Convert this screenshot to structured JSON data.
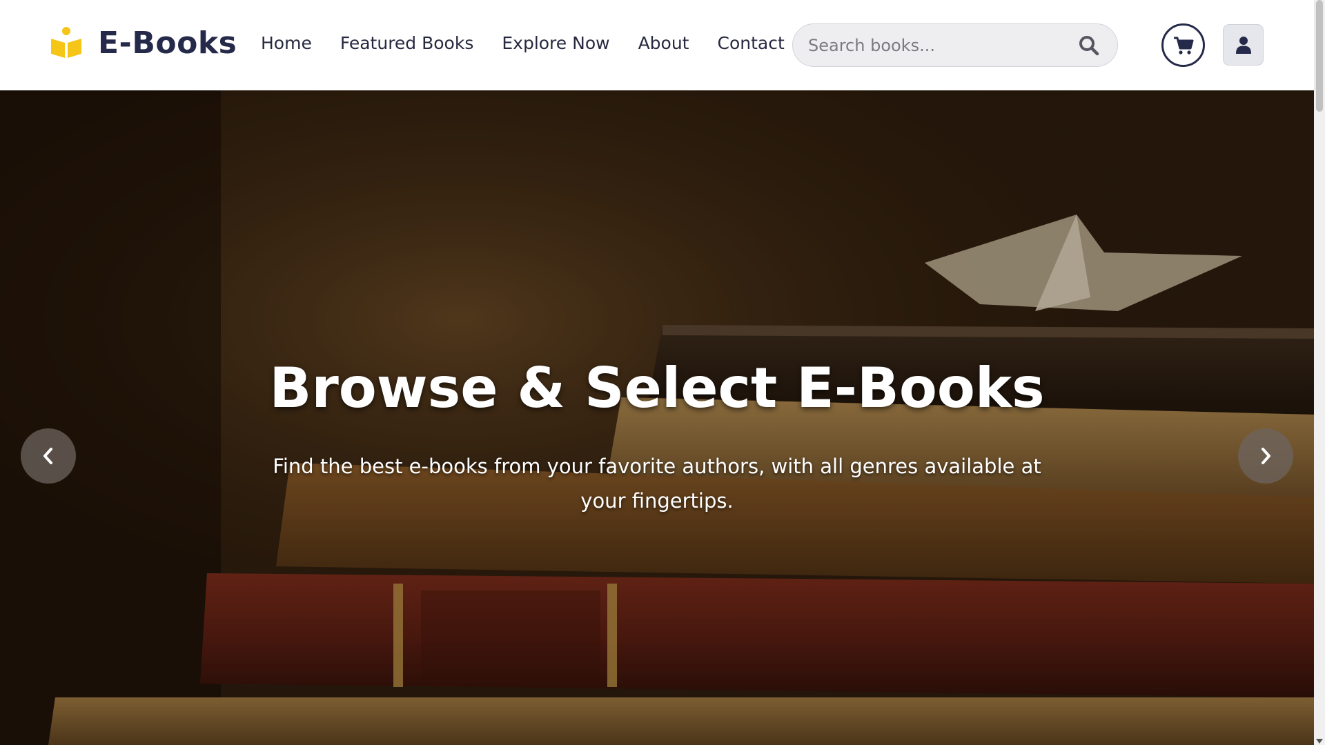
{
  "header": {
    "brand_name": "E-Books",
    "brand_icon": "book-reader-icon",
    "brand_color": "#f5c518",
    "nav": [
      "Home",
      "Featured Books",
      "Explore Now",
      "About",
      "Contact"
    ],
    "search": {
      "placeholder": "Search books...",
      "value": ""
    },
    "cart_icon": "shopping-cart-icon",
    "user_icon": "user-icon"
  },
  "hero": {
    "title": "Browse & Select E-Books",
    "subtitle": "Find the best e-books from your favorite authors, with all genres available at your fingertips.",
    "background": "stack-of-old-books-photo",
    "prev_icon": "chevron-left-icon",
    "next_icon": "chevron-right-icon"
  },
  "colors": {
    "header_bg": "#ffffff",
    "text_dark": "#262a4a",
    "accent": "#f5c518"
  }
}
